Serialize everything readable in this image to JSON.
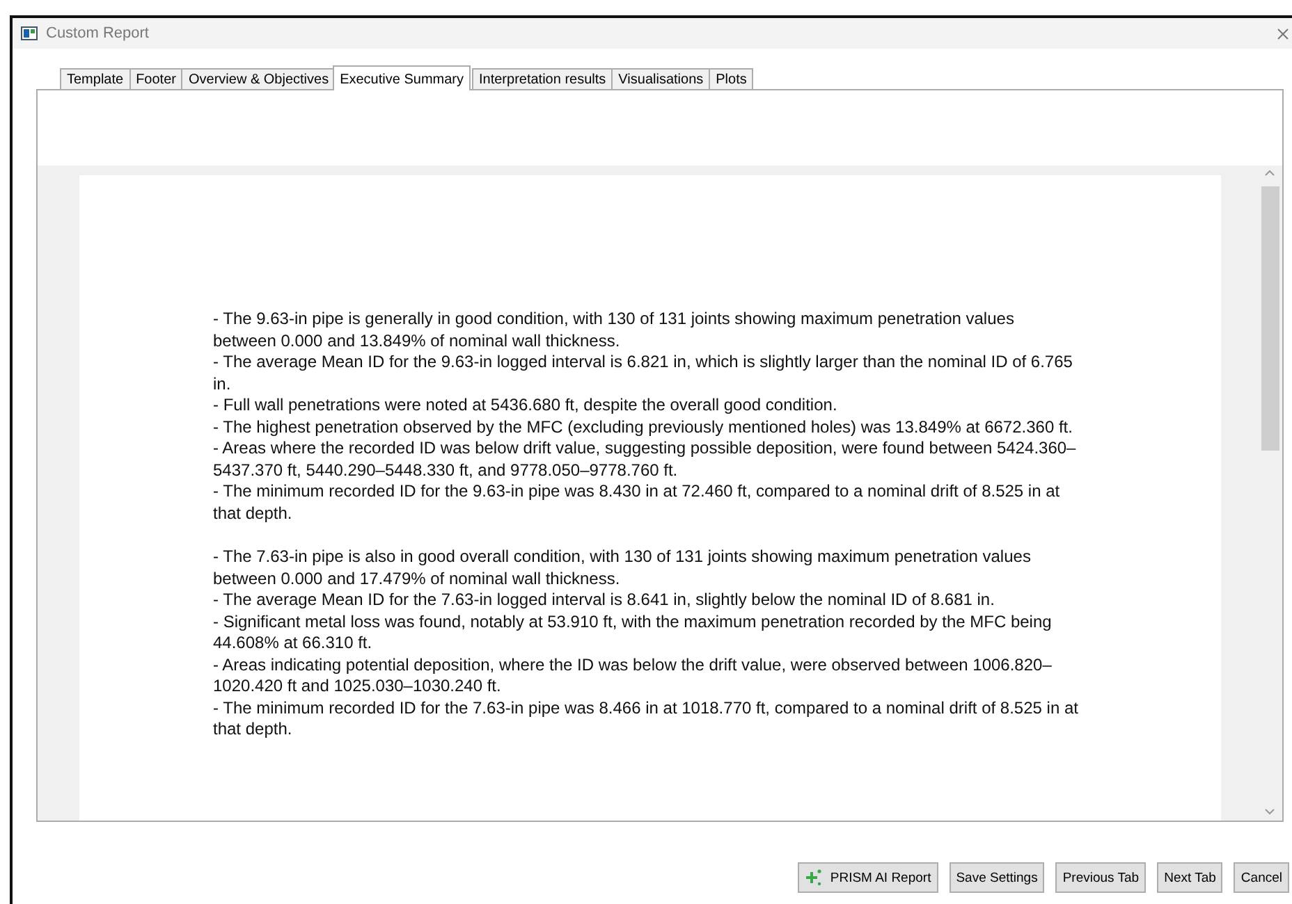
{
  "window": {
    "title": "Custom Report"
  },
  "tabs": [
    {
      "label": "Template",
      "selected": false
    },
    {
      "label": "Footer",
      "selected": false
    },
    {
      "label": "Overview & Objectives",
      "selected": false
    },
    {
      "label": "Executive Summary",
      "selected": true
    },
    {
      "label": "Interpretation results",
      "selected": false
    },
    {
      "label": "Visualisations",
      "selected": false
    },
    {
      "label": "Plots",
      "selected": false
    }
  ],
  "document": {
    "paragraphs": [
      [
        "- The 9.63-in pipe is generally in good condition, with 130 of 131 joints showing maximum penetration values between 0.000 and 13.849% of nominal wall thickness.",
        "- The average Mean ID for the 9.63-in logged interval is 6.821 in, which is slightly larger than the nominal ID of 6.765 in.",
        "- Full wall penetrations were noted at 5436.680 ft, despite the overall good condition.",
        "- The highest penetration observed by the MFC (excluding previously mentioned holes) was 13.849% at 6672.360 ft.",
        "- Areas where the recorded ID was below drift value, suggesting possible deposition, were found between 5424.360–5437.370 ft, 5440.290–5448.330 ft, and 9778.050–9778.760 ft.",
        "- The minimum recorded ID for the 9.63-in pipe was 8.430 in at 72.460 ft, compared to a nominal drift of 8.525 in at that depth."
      ],
      [
        "- The 7.63-in pipe is also in good overall condition, with 130 of 131 joints showing maximum penetration values between 0.000 and 17.479% of nominal wall thickness.",
        "- The average Mean ID for the 7.63-in logged interval is 8.641 in, slightly below the nominal ID of 8.681 in.",
        "- Significant metal loss was found, notably at 53.910 ft, with the maximum penetration recorded by the MFC being 44.608% at 66.310 ft.",
        "- Areas indicating potential deposition, where the ID was below the drift value, were observed between 1006.820–1020.420 ft and 1025.030–1030.240 ft.",
        "- The minimum recorded ID for the 7.63-in pipe was 8.466 in at 1018.770 ft, compared to a nominal drift of 8.525 in at that depth."
      ]
    ]
  },
  "buttons": [
    {
      "label": "PRISM AI Report",
      "kind": "ai"
    },
    {
      "label": "Save Settings",
      "kind": "plain"
    },
    {
      "label": "Previous Tab",
      "kind": "plain"
    },
    {
      "label": "Next Tab",
      "kind": "plain"
    },
    {
      "label": "Cancel",
      "kind": "plain"
    }
  ]
}
